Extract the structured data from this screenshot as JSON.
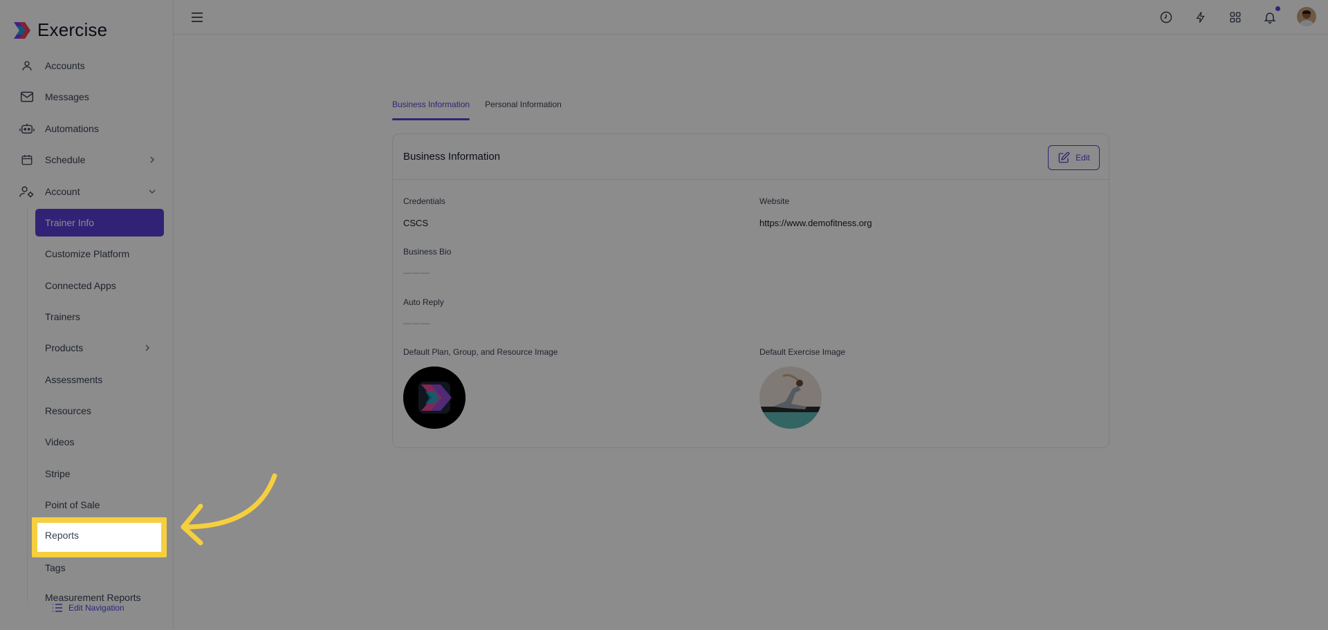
{
  "brand": {
    "name": "Exercise"
  },
  "sidebar": {
    "items": [
      {
        "label": "Accounts",
        "icon": "user-icon"
      },
      {
        "label": "Messages",
        "icon": "mail-icon"
      },
      {
        "label": "Automations",
        "icon": "robot-icon"
      },
      {
        "label": "Schedule",
        "icon": "calendar-icon"
      },
      {
        "label": "Account",
        "icon": "user-cog-icon"
      }
    ],
    "sub_items": [
      {
        "label": "Trainer Info"
      },
      {
        "label": "Customize Platform"
      },
      {
        "label": "Connected Apps"
      },
      {
        "label": "Trainers"
      },
      {
        "label": "Products"
      },
      {
        "label": "Assessments"
      },
      {
        "label": "Resources"
      },
      {
        "label": "Videos"
      },
      {
        "label": "Stripe"
      },
      {
        "label": "Point of Sale"
      },
      {
        "label": "Reports"
      },
      {
        "label": "Tags"
      },
      {
        "label": "Measurement Reports"
      }
    ],
    "edit_navigation": "Edit Navigation"
  },
  "tabs": [
    {
      "label": "Business Information"
    },
    {
      "label": "Personal Information"
    }
  ],
  "card": {
    "title": "Business Information",
    "edit_label": "Edit",
    "credentials_label": "Credentials",
    "credentials_value": "CSCS",
    "website_label": "Website",
    "website_value": "https://www.demofitness.org",
    "bio_label": "Business Bio",
    "bio_value": "———",
    "auto_reply_label": "Auto Reply",
    "auto_reply_value": "———",
    "default_plan_image_label": "Default Plan, Group, and Resource Image",
    "default_exercise_image_label": "Default Exercise Image"
  },
  "colors": {
    "accent": "#5b3fd6",
    "highlight": "#f6cf3f"
  }
}
